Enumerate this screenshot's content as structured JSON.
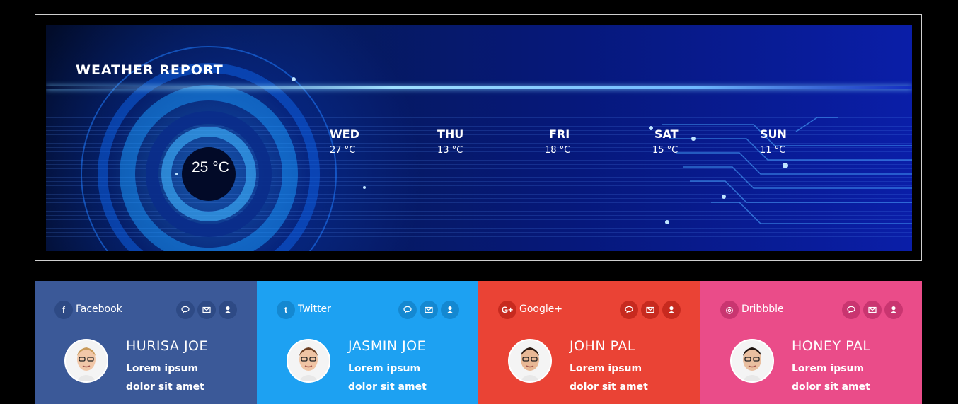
{
  "weather": {
    "title": "WEATHER REPORT",
    "current_temp": "25 °C",
    "days": [
      {
        "name": "WED",
        "temp": "27 °C"
      },
      {
        "name": "THU",
        "temp": "13 °C"
      },
      {
        "name": "FRI",
        "temp": "18 °C"
      },
      {
        "name": "SAT",
        "temp": "15 °C"
      },
      {
        "name": "SUN",
        "temp": "11 °C"
      }
    ]
  },
  "cards": [
    {
      "network": "Facebook",
      "icon": "facebook-icon",
      "glyph": "f",
      "color": "#3b5998",
      "dark": "#2e4a85",
      "name": "HURISA JOE",
      "line1": "Lorem ipsum",
      "line2": "dolor sit amet"
    },
    {
      "network": "Twitter",
      "icon": "twitter-icon",
      "glyph": "t",
      "color": "#1da1f2",
      "dark": "#1488d1",
      "name": "JASMIN JOE",
      "line1": "Lorem ipsum",
      "line2": "dolor sit amet"
    },
    {
      "network": "Google+",
      "icon": "google-plus-icon",
      "glyph": "G+",
      "color": "#ea4335",
      "dark": "#c72a1f",
      "name": "JOHN PAL",
      "line1": "Lorem ipsum",
      "line2": "dolor sit amet"
    },
    {
      "network": "Dribbble",
      "icon": "dribbble-icon",
      "glyph": "◎",
      "color": "#ea4c89",
      "dark": "#c93570",
      "name": "HONEY PAL",
      "line1": "Lorem ipsum",
      "line2": "dolor sit amet"
    }
  ]
}
